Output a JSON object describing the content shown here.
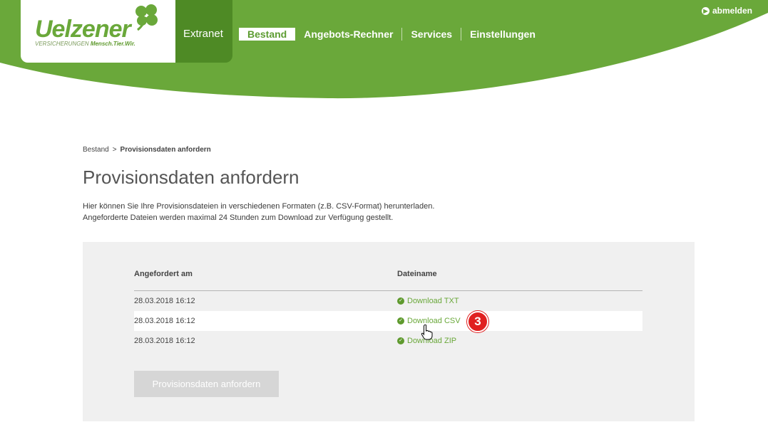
{
  "header": {
    "logo": {
      "word": "Uelzener",
      "sub_plain": "VERSICHERUNGEN",
      "sub_bold": "Mensch.Tier.Wir."
    },
    "app_label": "Extranet",
    "nav": [
      "Bestand",
      "Angebots-Rechner",
      "Services",
      "Einstellungen"
    ],
    "active_nav": "Bestand",
    "logout_label": "abmelden"
  },
  "breadcrumb": {
    "parent": "Bestand",
    "separator": ">",
    "current": "Provisionsdaten anfordern"
  },
  "page": {
    "title": "Provisionsdaten anfordern",
    "intro": "Hier können Sie Ihre Provisionsdateien in verschiedenen Formaten (z.B. CSV-Format) herunterladen. Angeforderte Dateien werden maximal 24 Stunden zum Download zur Verfügung gestellt."
  },
  "table": {
    "headers": [
      "Angefordert am",
      "Dateiname"
    ],
    "rows": [
      {
        "date": "28.03.2018 16:12",
        "file": "Download TXT"
      },
      {
        "date": "28.03.2018 16:12",
        "file": "Download CSV"
      },
      {
        "date": "28.03.2018 16:12",
        "file": "Download ZIP"
      }
    ]
  },
  "submit_label": "Provisionsdaten anfordern",
  "step_badge": "3",
  "colors": {
    "brand_green": "#6aa83a",
    "dark_green": "#4e8a25",
    "badge_red": "#e02020",
    "panel_bg": "#f0f0f0"
  }
}
